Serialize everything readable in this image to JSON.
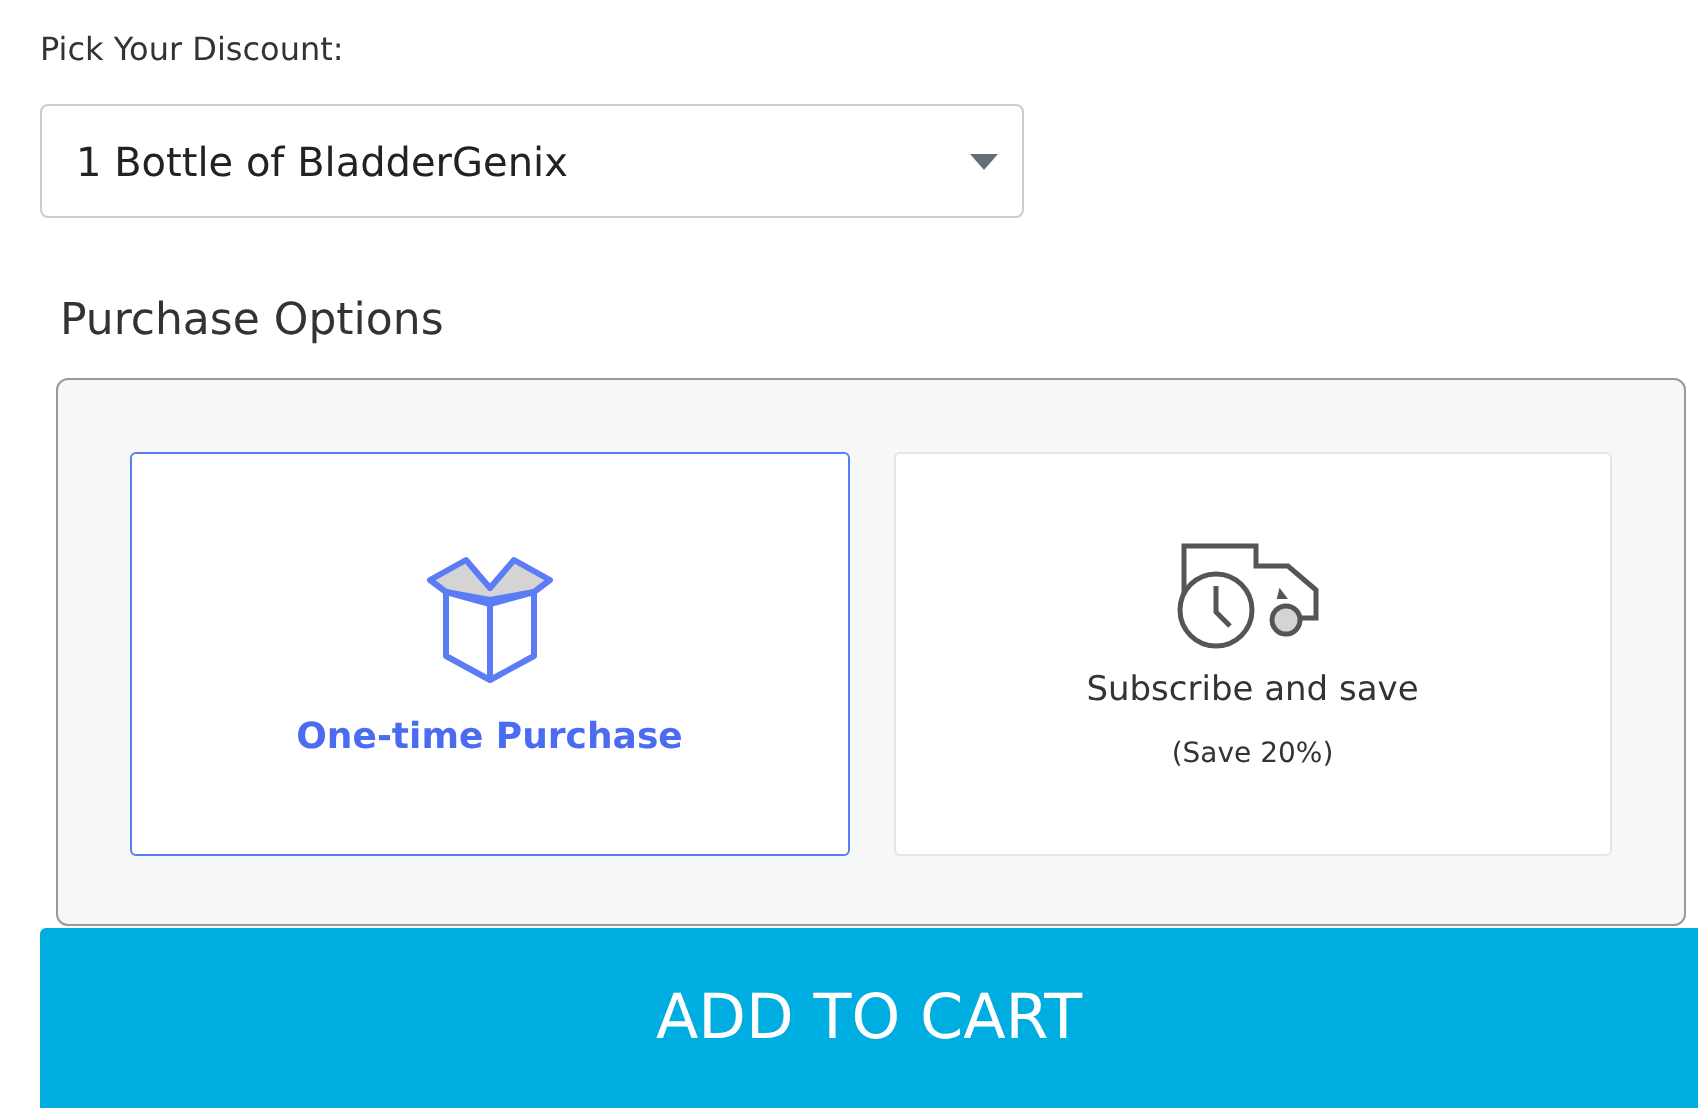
{
  "discount": {
    "label": "Pick Your Discount:",
    "value": "1 Bottle of BladderGenix"
  },
  "purchase_options": {
    "title": "Purchase Options",
    "options": [
      {
        "kind": "onetime",
        "label": "One-time Purchase",
        "selected": true
      },
      {
        "kind": "subscribe",
        "label": "Subscribe and save",
        "note": "(Save 20%)",
        "selected": false
      }
    ]
  },
  "add_to_cart": "ADD TO CART"
}
